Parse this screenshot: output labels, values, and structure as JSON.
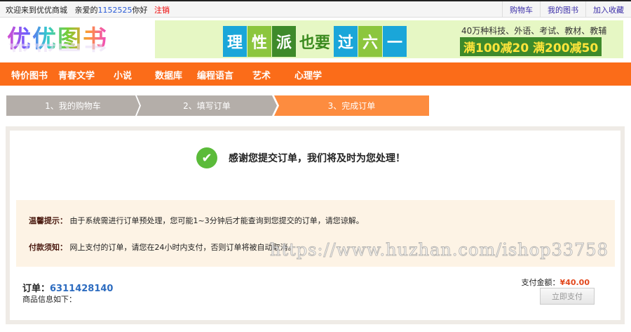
{
  "topbar": {
    "welcome": "欢迎来到优优商城",
    "greet_prefix": "亲爱的",
    "username": "1152525",
    "greet_suffix": "你好",
    "logout": "注销",
    "links": [
      "购物车",
      "我的图书",
      "加入收藏"
    ]
  },
  "logo": "优优图书",
  "banner": {
    "tiles": [
      "理",
      "性",
      "派",
      "也要",
      "过",
      "六",
      "一"
    ],
    "sub": "40万种科技、外语、考试、教材、教辅",
    "deal": "满100减20 满200减50"
  },
  "nav": [
    "特价图书",
    "青春文学",
    "小说",
    "数据库",
    "编程语言",
    "艺术",
    "心理学"
  ],
  "steps": [
    "1、我的购物车",
    "2、填写订单",
    "3、完成订单"
  ],
  "thanks": "感谢您提交订单，我们将及时为您处理！",
  "tips": {
    "label1": "温馨提示：",
    "text1": "由于系统需进行订单预处理，您可能1~3分钟后才能查询到您提交的订单，请您谅解。",
    "label2": "付款须知：",
    "text2": "网上支付的订单，请您在24小时内支付，否则订单将被自动取消。"
  },
  "watermark": "https://www.huzhan.com/ishop33758",
  "order": {
    "label": "订单：",
    "number": "6311428140",
    "info": "商品信息如下：",
    "pay_label": "支付金额：",
    "amount": "¥40.00",
    "pay_button": "立即支付"
  },
  "colors": {
    "accent": "#fb6c19",
    "step_active": "#fd8c3f",
    "step_inactive": "#b4aea9",
    "tips_bg": "#fdf3e5"
  }
}
